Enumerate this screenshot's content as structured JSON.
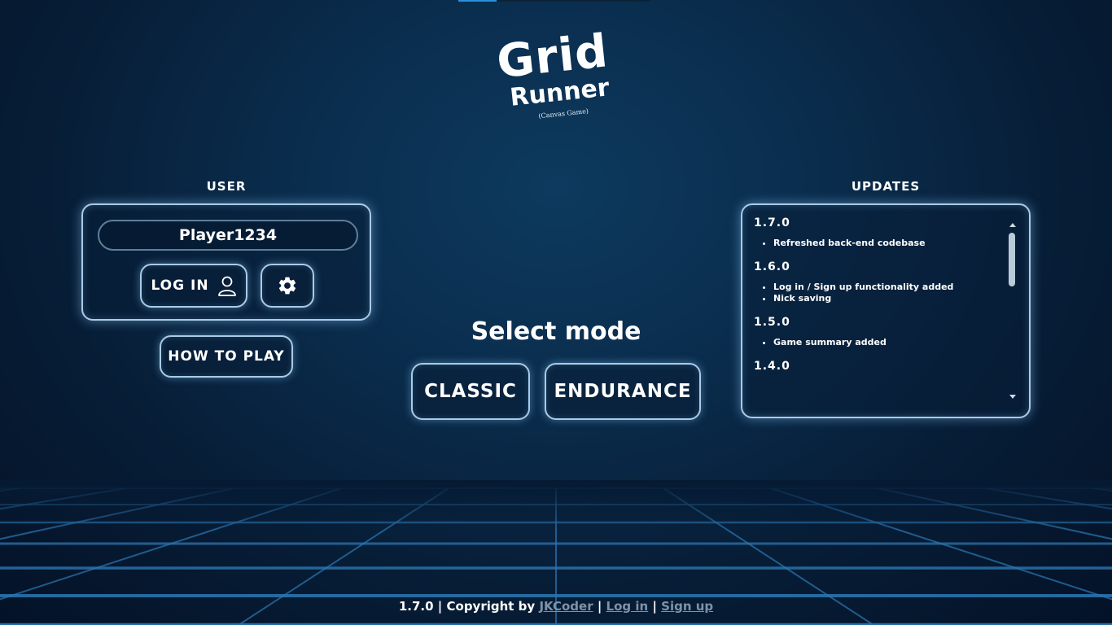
{
  "loader": {
    "progress": 0.2
  },
  "logo": {
    "line1": "Grid",
    "line2": "Runner",
    "subtitle": "(Canvas Game)"
  },
  "user": {
    "title": "USER",
    "nickname": "Player1234",
    "login_label": "LOG IN",
    "how_to_play_label": "HOW TO PLAY"
  },
  "mode": {
    "title": "Select mode",
    "classic_label": "CLASSIC",
    "endurance_label": "ENDURANCE"
  },
  "updates": {
    "title": "UPDATES",
    "entries": [
      {
        "version": "1.7.0",
        "items": [
          "Refreshed back-end codebase"
        ]
      },
      {
        "version": "1.6.0",
        "items": [
          "Log in / Sign up functionality added",
          "Nick saving"
        ]
      },
      {
        "version": "1.5.0",
        "items": [
          "Game summary added"
        ]
      },
      {
        "version": "1.4.0",
        "items": []
      }
    ]
  },
  "footer": {
    "version": "1.7.0",
    "copyright": "Copyright by",
    "author": "JKCoder",
    "login": "Log in",
    "signup": "Sign up",
    "separator": "|"
  },
  "colors": {
    "accent_border": "#a9cbe6",
    "grid_line": "#2c78b4",
    "footer_link": "#7f93a6"
  }
}
